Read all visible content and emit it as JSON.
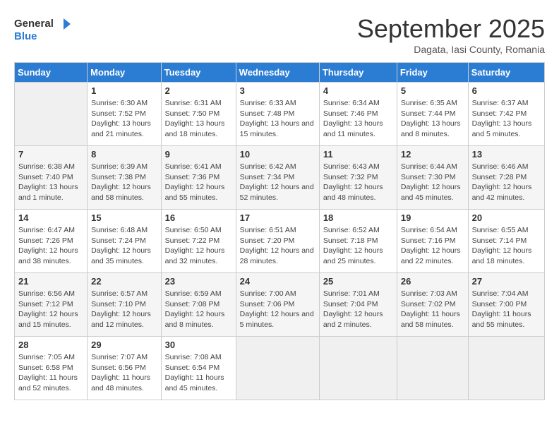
{
  "logo": {
    "text_general": "General",
    "text_blue": "Blue"
  },
  "header": {
    "month": "September 2025",
    "location": "Dagata, Iasi County, Romania"
  },
  "days_of_week": [
    "Sunday",
    "Monday",
    "Tuesday",
    "Wednesday",
    "Thursday",
    "Friday",
    "Saturday"
  ],
  "weeks": [
    [
      {
        "day": "",
        "empty": true
      },
      {
        "day": "1",
        "sunrise": "Sunrise: 6:30 AM",
        "sunset": "Sunset: 7:52 PM",
        "daylight": "Daylight: 13 hours and 21 minutes."
      },
      {
        "day": "2",
        "sunrise": "Sunrise: 6:31 AM",
        "sunset": "Sunset: 7:50 PM",
        "daylight": "Daylight: 13 hours and 18 minutes."
      },
      {
        "day": "3",
        "sunrise": "Sunrise: 6:33 AM",
        "sunset": "Sunset: 7:48 PM",
        "daylight": "Daylight: 13 hours and 15 minutes."
      },
      {
        "day": "4",
        "sunrise": "Sunrise: 6:34 AM",
        "sunset": "Sunset: 7:46 PM",
        "daylight": "Daylight: 13 hours and 11 minutes."
      },
      {
        "day": "5",
        "sunrise": "Sunrise: 6:35 AM",
        "sunset": "Sunset: 7:44 PM",
        "daylight": "Daylight: 13 hours and 8 minutes."
      },
      {
        "day": "6",
        "sunrise": "Sunrise: 6:37 AM",
        "sunset": "Sunset: 7:42 PM",
        "daylight": "Daylight: 13 hours and 5 minutes."
      }
    ],
    [
      {
        "day": "7",
        "sunrise": "Sunrise: 6:38 AM",
        "sunset": "Sunset: 7:40 PM",
        "daylight": "Daylight: 13 hours and 1 minute."
      },
      {
        "day": "8",
        "sunrise": "Sunrise: 6:39 AM",
        "sunset": "Sunset: 7:38 PM",
        "daylight": "Daylight: 12 hours and 58 minutes."
      },
      {
        "day": "9",
        "sunrise": "Sunrise: 6:41 AM",
        "sunset": "Sunset: 7:36 PM",
        "daylight": "Daylight: 12 hours and 55 minutes."
      },
      {
        "day": "10",
        "sunrise": "Sunrise: 6:42 AM",
        "sunset": "Sunset: 7:34 PM",
        "daylight": "Daylight: 12 hours and 52 minutes."
      },
      {
        "day": "11",
        "sunrise": "Sunrise: 6:43 AM",
        "sunset": "Sunset: 7:32 PM",
        "daylight": "Daylight: 12 hours and 48 minutes."
      },
      {
        "day": "12",
        "sunrise": "Sunrise: 6:44 AM",
        "sunset": "Sunset: 7:30 PM",
        "daylight": "Daylight: 12 hours and 45 minutes."
      },
      {
        "day": "13",
        "sunrise": "Sunrise: 6:46 AM",
        "sunset": "Sunset: 7:28 PM",
        "daylight": "Daylight: 12 hours and 42 minutes."
      }
    ],
    [
      {
        "day": "14",
        "sunrise": "Sunrise: 6:47 AM",
        "sunset": "Sunset: 7:26 PM",
        "daylight": "Daylight: 12 hours and 38 minutes."
      },
      {
        "day": "15",
        "sunrise": "Sunrise: 6:48 AM",
        "sunset": "Sunset: 7:24 PM",
        "daylight": "Daylight: 12 hours and 35 minutes."
      },
      {
        "day": "16",
        "sunrise": "Sunrise: 6:50 AM",
        "sunset": "Sunset: 7:22 PM",
        "daylight": "Daylight: 12 hours and 32 minutes."
      },
      {
        "day": "17",
        "sunrise": "Sunrise: 6:51 AM",
        "sunset": "Sunset: 7:20 PM",
        "daylight": "Daylight: 12 hours and 28 minutes."
      },
      {
        "day": "18",
        "sunrise": "Sunrise: 6:52 AM",
        "sunset": "Sunset: 7:18 PM",
        "daylight": "Daylight: 12 hours and 25 minutes."
      },
      {
        "day": "19",
        "sunrise": "Sunrise: 6:54 AM",
        "sunset": "Sunset: 7:16 PM",
        "daylight": "Daylight: 12 hours and 22 minutes."
      },
      {
        "day": "20",
        "sunrise": "Sunrise: 6:55 AM",
        "sunset": "Sunset: 7:14 PM",
        "daylight": "Daylight: 12 hours and 18 minutes."
      }
    ],
    [
      {
        "day": "21",
        "sunrise": "Sunrise: 6:56 AM",
        "sunset": "Sunset: 7:12 PM",
        "daylight": "Daylight: 12 hours and 15 minutes."
      },
      {
        "day": "22",
        "sunrise": "Sunrise: 6:57 AM",
        "sunset": "Sunset: 7:10 PM",
        "daylight": "Daylight: 12 hours and 12 minutes."
      },
      {
        "day": "23",
        "sunrise": "Sunrise: 6:59 AM",
        "sunset": "Sunset: 7:08 PM",
        "daylight": "Daylight: 12 hours and 8 minutes."
      },
      {
        "day": "24",
        "sunrise": "Sunrise: 7:00 AM",
        "sunset": "Sunset: 7:06 PM",
        "daylight": "Daylight: 12 hours and 5 minutes."
      },
      {
        "day": "25",
        "sunrise": "Sunrise: 7:01 AM",
        "sunset": "Sunset: 7:04 PM",
        "daylight": "Daylight: 12 hours and 2 minutes."
      },
      {
        "day": "26",
        "sunrise": "Sunrise: 7:03 AM",
        "sunset": "Sunset: 7:02 PM",
        "daylight": "Daylight: 11 hours and 58 minutes."
      },
      {
        "day": "27",
        "sunrise": "Sunrise: 7:04 AM",
        "sunset": "Sunset: 7:00 PM",
        "daylight": "Daylight: 11 hours and 55 minutes."
      }
    ],
    [
      {
        "day": "28",
        "sunrise": "Sunrise: 7:05 AM",
        "sunset": "Sunset: 6:58 PM",
        "daylight": "Daylight: 11 hours and 52 minutes."
      },
      {
        "day": "29",
        "sunrise": "Sunrise: 7:07 AM",
        "sunset": "Sunset: 6:56 PM",
        "daylight": "Daylight: 11 hours and 48 minutes."
      },
      {
        "day": "30",
        "sunrise": "Sunrise: 7:08 AM",
        "sunset": "Sunset: 6:54 PM",
        "daylight": "Daylight: 11 hours and 45 minutes."
      },
      {
        "day": "",
        "empty": true
      },
      {
        "day": "",
        "empty": true
      },
      {
        "day": "",
        "empty": true
      },
      {
        "day": "",
        "empty": true
      }
    ]
  ]
}
